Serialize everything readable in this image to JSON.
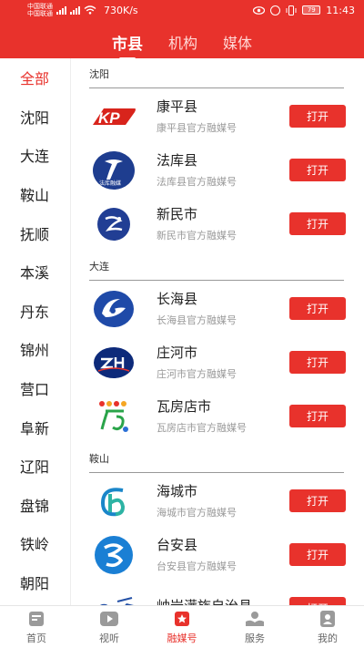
{
  "status_bar": {
    "carrier1": "中国联通",
    "carrier2": "中国联通",
    "net_type": "4G",
    "speed": "730K/s",
    "battery": "79",
    "time": "11:43"
  },
  "tabs": [
    {
      "label": "市县",
      "active": true
    },
    {
      "label": "机构",
      "active": false
    },
    {
      "label": "媒体",
      "active": false
    }
  ],
  "sidebar": {
    "items": [
      {
        "label": "全部",
        "active": true
      },
      {
        "label": "沈阳"
      },
      {
        "label": "大连"
      },
      {
        "label": "鞍山"
      },
      {
        "label": "抚顺"
      },
      {
        "label": "本溪"
      },
      {
        "label": "丹东"
      },
      {
        "label": "锦州"
      },
      {
        "label": "营口"
      },
      {
        "label": "阜新"
      },
      {
        "label": "辽阳"
      },
      {
        "label": "盘锦"
      },
      {
        "label": "铁岭"
      },
      {
        "label": "朝阳"
      }
    ]
  },
  "sections": [
    {
      "title": "沈阳",
      "items": [
        {
          "name": "康平县",
          "desc": "康平县官方融媒号",
          "button": "打开",
          "logo": "kangping-logo"
        },
        {
          "name": "法库县",
          "desc": "法库县官方融媒号",
          "button": "打开",
          "logo": "faku-logo"
        },
        {
          "name": "新民市",
          "desc": "新民市官方融媒号",
          "button": "打开",
          "logo": "xinmin-logo"
        }
      ]
    },
    {
      "title": "大连",
      "items": [
        {
          "name": "长海县",
          "desc": "长海县官方融媒号",
          "button": "打开",
          "logo": "changhai-logo"
        },
        {
          "name": "庄河市",
          "desc": "庄河市官方融媒号",
          "button": "打开",
          "logo": "zhuanghe-logo"
        },
        {
          "name": "瓦房店市",
          "desc": "瓦房店市官方融媒号",
          "button": "打开",
          "logo": "wafangdian-logo"
        }
      ]
    },
    {
      "title": "鞍山",
      "items": [
        {
          "name": "海城市",
          "desc": "海城市官方融媒号",
          "button": "打开",
          "logo": "haicheng-logo"
        },
        {
          "name": "台安县",
          "desc": "台安县官方融媒号",
          "button": "打开",
          "logo": "taian-logo"
        },
        {
          "name": "岫岩满族自治县",
          "desc": "",
          "button": "打开",
          "logo": "xiuyan-logo"
        }
      ]
    }
  ],
  "bottom_nav": [
    {
      "label": "首页",
      "icon": "home-icon"
    },
    {
      "label": "视听",
      "icon": "play-icon"
    },
    {
      "label": "融媒号",
      "icon": "star-badge-icon",
      "active": true
    },
    {
      "label": "服务",
      "icon": "hand-service-icon"
    },
    {
      "label": "我的",
      "icon": "user-icon"
    }
  ],
  "colors": {
    "accent": "#e8322c",
    "sidebar_active": "#e8322c"
  }
}
